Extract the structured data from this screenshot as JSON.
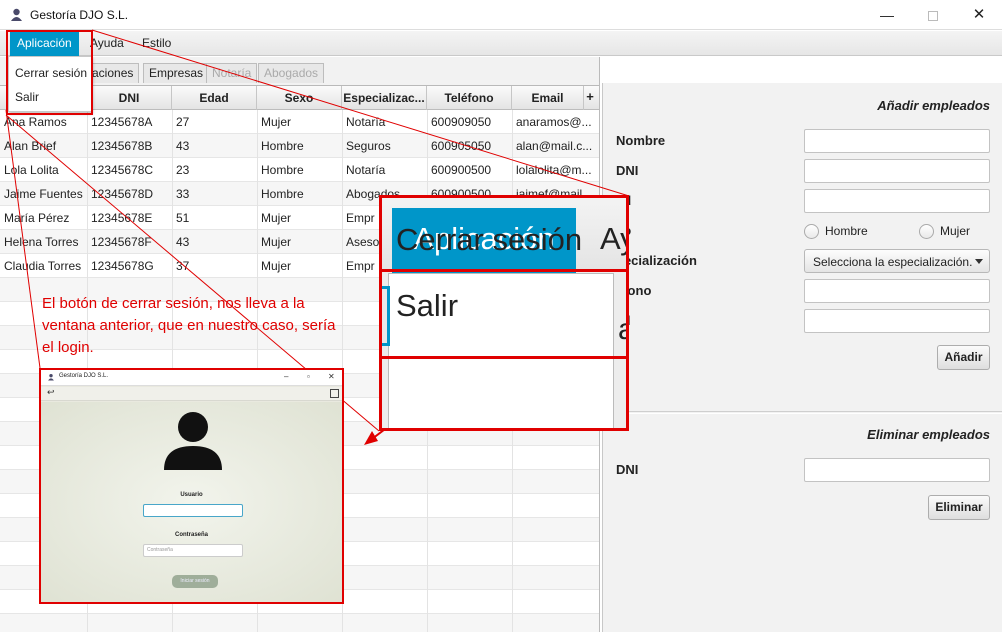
{
  "window": {
    "title": "Gestoría DJO S.L.",
    "minimize": "—",
    "close": "✕"
  },
  "menubar": {
    "items": [
      "Aplicación",
      "Ayuda",
      "Estilo"
    ]
  },
  "dropdown": {
    "items": [
      "Cerrar sesión",
      "Salir"
    ]
  },
  "tabs": [
    {
      "label": "aciones",
      "disabled": false
    },
    {
      "label": "Empresas",
      "disabled": false
    },
    {
      "label": "Notaría",
      "disabled": true
    },
    {
      "label": "Abogados",
      "disabled": true
    }
  ],
  "table": {
    "columns": [
      "DNI",
      "Edad",
      "Sexo",
      "Especializac...",
      "Teléfono",
      "Email"
    ],
    "add_column_glyph": "+",
    "rows": [
      [
        "Ana Ramos",
        "12345678A",
        "27",
        "Mujer",
        "Notaría",
        "600909050",
        "anaramos@..."
      ],
      [
        "Alan Brief",
        "12345678B",
        "43",
        "Hombre",
        "Seguros",
        "600905050",
        "alan@mail.c..."
      ],
      [
        "Lola Lolita",
        "12345678C",
        "23",
        "Hombre",
        "Notaría",
        "600900500",
        "lolalolita@m..."
      ],
      [
        "Jaime Fuentes",
        "12345678D",
        "33",
        "Hombre",
        "Abogados",
        "600900500",
        "jaimef@mail..."
      ],
      [
        "María Pérez",
        "12345678E",
        "51",
        "Mujer",
        "Empr",
        "",
        ""
      ],
      [
        "Helena Torres",
        "12345678F",
        "43",
        "Mujer",
        "Aseso",
        "",
        ""
      ],
      [
        "Claudia Torres",
        "12345678G",
        "37",
        "Mujer",
        "Empr",
        "",
        ""
      ]
    ]
  },
  "add_form": {
    "title": "Añadir empleados",
    "labels": {
      "name": "Nombre",
      "dni": "DNI",
      "age": "ad",
      "sex": "xo",
      "specialization": "pecialización",
      "phone": "éfono",
      "email": "ail"
    },
    "sex_options": [
      "Hombre",
      "Mujer"
    ],
    "specialization_placeholder": "Selecciona la especialización.",
    "submit": "Añadir"
  },
  "delete_form": {
    "title": "Eliminar empleados",
    "dni_label": "DNI",
    "submit": "Eliminar"
  },
  "zoom": {
    "menu": "Aplicación",
    "menu_next": "Ay",
    "item_logout": "Cerrar sesión",
    "item_exit": "Salir",
    "side_fragment": "a"
  },
  "annotation": {
    "note": "El botón de cerrar sesión, nos lleva a la ventana anterior, que en nuestro caso, sería el login.",
    "color": "#e00000"
  },
  "login_preview": {
    "title": "Gestoría DJO S.L.",
    "username_label": "Usuario",
    "password_label": "Contraseña",
    "password_placeholder": "Contraseña",
    "login_button": "Iniciar sesión"
  },
  "colors": {
    "accent": "#0096c9",
    "annotation": "#e00000"
  }
}
